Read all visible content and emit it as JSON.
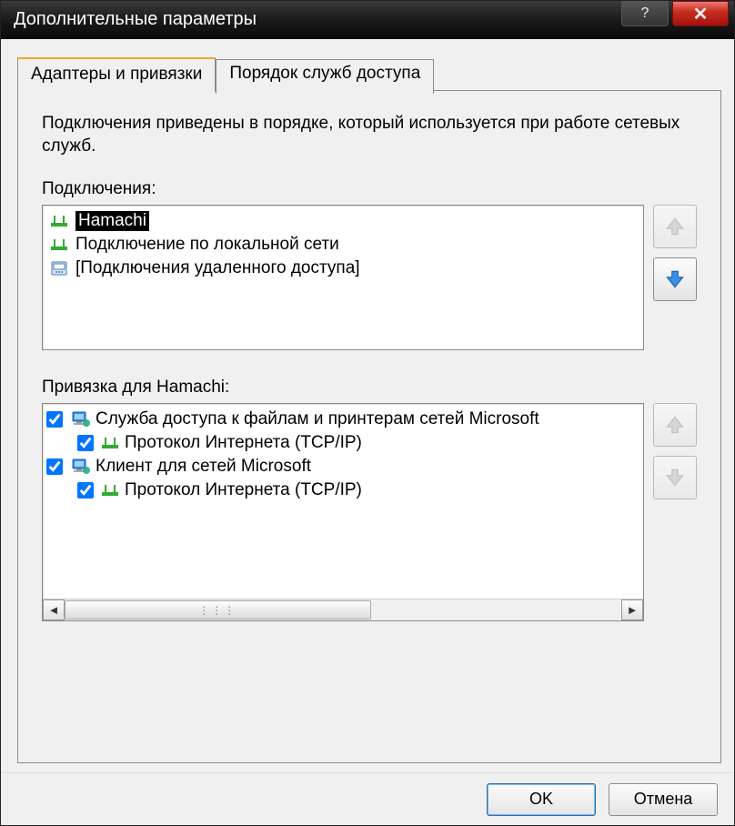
{
  "window": {
    "title": "Дополнительные параметры"
  },
  "tabs": {
    "adapters": "Адаптеры и привязки",
    "provider_order": "Порядок служб доступа"
  },
  "panel": {
    "description": "Подключения приведены в порядке, который используется при работе сетевых служб.",
    "connections_label": "Подключения:",
    "connections": [
      {
        "name": "Hamachi",
        "icon": "nic",
        "selected": true
      },
      {
        "name": "Подключение по локальной сети",
        "icon": "nic",
        "selected": false
      },
      {
        "name": "[Подключения удаленного доступа]",
        "icon": "dialup",
        "selected": false
      }
    ],
    "bindings_label": "Привязка для Hamachi:",
    "bindings": [
      {
        "name": "Служба доступа к файлам и принтерам сетей Microsoft",
        "icon": "net",
        "checked": true,
        "level": 0
      },
      {
        "name": "Протокол Интернета (TCP/IP)",
        "icon": "nic",
        "checked": true,
        "level": 1
      },
      {
        "name": "Клиент для сетей Microsoft",
        "icon": "net",
        "checked": true,
        "level": 0
      },
      {
        "name": "Протокол Интернета (TCP/IP)",
        "icon": "nic",
        "checked": true,
        "level": 1
      }
    ]
  },
  "buttons": {
    "ok": "OK",
    "cancel": "Отмена"
  }
}
